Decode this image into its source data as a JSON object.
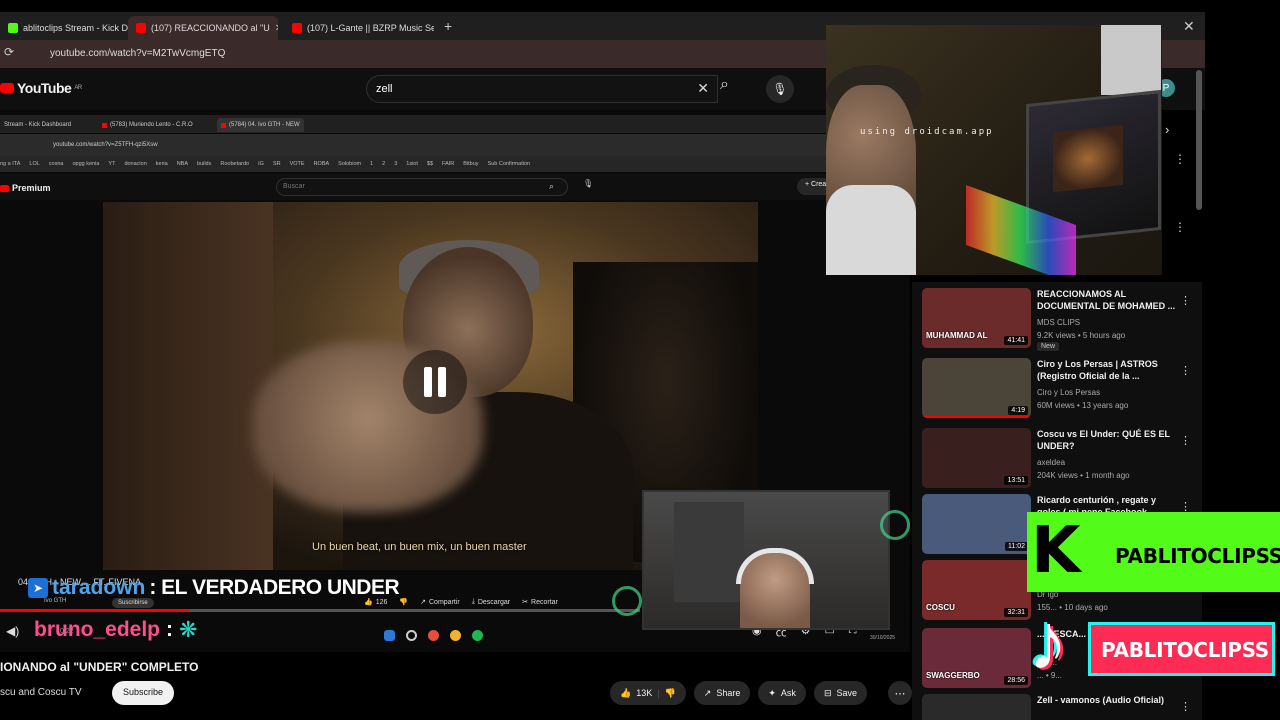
{
  "browser": {
    "tabs": [
      {
        "label": "ablitoclips Stream - Kick Dashb",
        "active": false
      },
      {
        "label": "(107) REACCIONANDO al \"U",
        "active": true
      },
      {
        "label": "(107) L-Gante || BZRP Music Se",
        "active": false
      }
    ],
    "url": "youtube.com/watch?v=M2TwVcmgETQ"
  },
  "youtube": {
    "logo": "YouTube",
    "region": "AR",
    "search_value": "zell",
    "avatar_letter": "P"
  },
  "inner": {
    "tabs": [
      "Stream - Kick Dashboard",
      "(5783) Muriendo Lento - C.R.O",
      "(5784) 04. Ivo GTH - NEW"
    ],
    "url": "youtube.com/watch?v=Z5TFH-qzi5Xsw",
    "bookmarks": [
      "ng a ITA",
      "LOL",
      "cosna",
      "opgg kenia",
      "YT",
      "donacion",
      "keria",
      "NBA",
      "builds",
      "Roobetardo",
      "IG",
      "SR",
      "VOTE",
      "ROBA",
      "Solobiom",
      "1",
      "2",
      "3",
      "1siot",
      "$$",
      "FAIR",
      "Bitbuy",
      "Sub Confirmation"
    ],
    "logo": "Premium",
    "search_placeholder": "Buscar",
    "create": "+ Crear",
    "subtitle": "Un buen beat, un buen mix, un buen master",
    "title_row": "04. GTH - NEW ... FT. FIVENA",
    "channel": "Ivo GTH",
    "subscribe": "Suscribirse",
    "likes": "126",
    "share": "Compartir",
    "download": "Descargar",
    "clip": "Recortar",
    "time": "0:22",
    "clock": "30/10/2025"
  },
  "chat": [
    {
      "user": "taradown",
      "message": ": EL VERDADERO UNDER"
    },
    {
      "user": "bruno_edelp",
      "message": ":"
    }
  ],
  "video_title": "IONANDO al \"UNDER\" COMPLETO",
  "owner": "scu and Coscu TV",
  "subscribe_label": "Subscribe",
  "actions": {
    "likes": "13K",
    "share": "Share",
    "ask": "Ask",
    "save": "Save"
  },
  "webcam_watermark": "using droidcam.app",
  "recommendations": [
    {
      "title": "REACCIONAMOS AL DOCUMENTAL DE MOHAMED ...",
      "channel": "MDS CLIPS",
      "meta": "9.2K views • 5 hours ago",
      "duration": "41:41",
      "badge": "New",
      "thumb_text": "MUHAMMAD AL",
      "bg": "#6b2b2b",
      "progress": 0
    },
    {
      "title": "Ciro y Los Persas | ASTROS (Registro Oficial de la ...",
      "channel": "Ciro y Los Persas",
      "meta": "60M views • 13 years ago",
      "duration": "4:19",
      "badge": "",
      "thumb_text": "",
      "bg": "#4a4538",
      "progress": 1
    },
    {
      "title": "Coscu vs El Under: QUÉ ES EL UNDER?",
      "channel": "axeldea",
      "meta": "204K views • 1 month ago",
      "duration": "13:51",
      "badge": "",
      "thumb_text": "",
      "bg": "#3a1f1f",
      "progress": 0
    },
    {
      "title": "Ricardo centurión , regate y goles ( mi nene Facebook",
      "channel": "Payyito91_el_mats",
      "meta": "6 mo",
      "duration": "11:02",
      "badge": "",
      "thumb_text": "",
      "bg": "#4a5a7a",
      "progress": 0
    },
    {
      "title": "... setup ... (... edad)",
      "channel": "Dr igo",
      "meta": "155... • 10 days ago",
      "duration": "32:31",
      "badge": "",
      "thumb_text": "COSCU",
      "bg": "#7a2a2a",
      "progress": 0
    },
    {
      "title": "... RESCA...",
      "channel": "HIS...",
      "meta": "... • 9...",
      "duration": "28:56",
      "badge": "",
      "thumb_text": "SWAGGERBO",
      "bg": "#6a2a3a",
      "progress": 0
    },
    {
      "title": "Zell - vamonos (Audio Oficial)",
      "channel": "Zell",
      "meta": "",
      "duration": "",
      "badge": "",
      "thumb_text": "",
      "bg": "#2a2a2a",
      "progress": 0
    }
  ],
  "branding": {
    "kick_letter": "K",
    "kick_name": "PABLITOCLIPSS",
    "tiktok_name": "PABLITOCLIPSS",
    "kick_color": "#53fc18",
    "tiktok_color": "#fe2c55"
  }
}
